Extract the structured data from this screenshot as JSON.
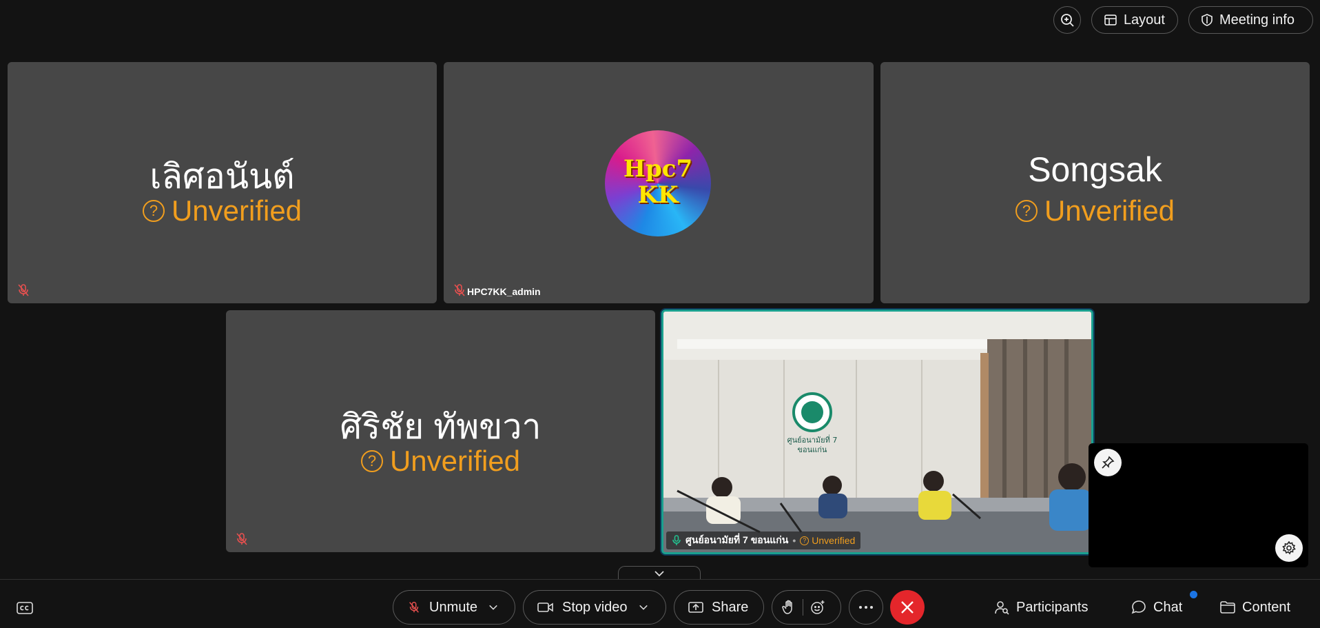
{
  "topbar": {
    "zoom_icon": "zoom-in-icon",
    "layout_label": "Layout",
    "meeting_info_label": "Meeting info"
  },
  "tiles": [
    {
      "display_name": "เลิศอนันต์",
      "status": "Unverified"
    },
    {
      "avatar_text_line1": "Hpc7",
      "avatar_text_line2": "KK",
      "name_tag": "HPC7KK_admin"
    },
    {
      "display_name": "Songsak",
      "status": "Unverified"
    },
    {
      "display_name": "ศิริชัย ทัพขวา",
      "status": "Unverified"
    }
  ],
  "video_tile": {
    "name": "ศูนย์อนามัยที่ 7 ขอนแก่น",
    "status": "Unverified",
    "wall_sign_line1": "ศูนย์อนามัยที่ 7",
    "wall_sign_line2": "ขอนแก่น"
  },
  "controls": {
    "unmute_label": "Unmute",
    "stop_video_label": "Stop video",
    "share_label": "Share"
  },
  "right_controls": {
    "participants_label": "Participants",
    "chat_label": "Chat",
    "content_label": "Content"
  },
  "colors": {
    "unverified": "#f19e1e",
    "end_call": "#e4262b",
    "active_speaker_border": "#1aa08f",
    "notification_dot": "#1b74e4"
  }
}
